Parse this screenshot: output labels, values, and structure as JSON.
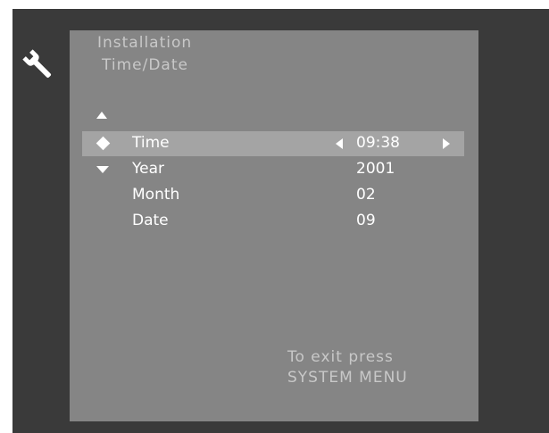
{
  "header": {
    "line1": "Installation",
    "line2": "Time/Date"
  },
  "menu": {
    "items": [
      {
        "label": "Time",
        "value": "09:38",
        "selected": true
      },
      {
        "label": "Year",
        "value": "2001"
      },
      {
        "label": "Month",
        "value": "02"
      },
      {
        "label": "Date",
        "value": "09"
      }
    ]
  },
  "footer": {
    "line1": "To exit press",
    "line2": "SYSTEM MENU"
  },
  "icons": {
    "tool": "wrench-icon",
    "scroll_up": "arrow-up-icon",
    "scroll_down": "arrow-down-icon",
    "cursor": "diamond-icon",
    "dec": "triangle-left-icon",
    "inc": "triangle-right-icon"
  },
  "colors": {
    "screen_bg": "#3a3a3a",
    "panel_bg": "#858585",
    "highlight": "#a4a4a4",
    "text": "#ffffff",
    "dim_text": "#c8c8c8"
  }
}
